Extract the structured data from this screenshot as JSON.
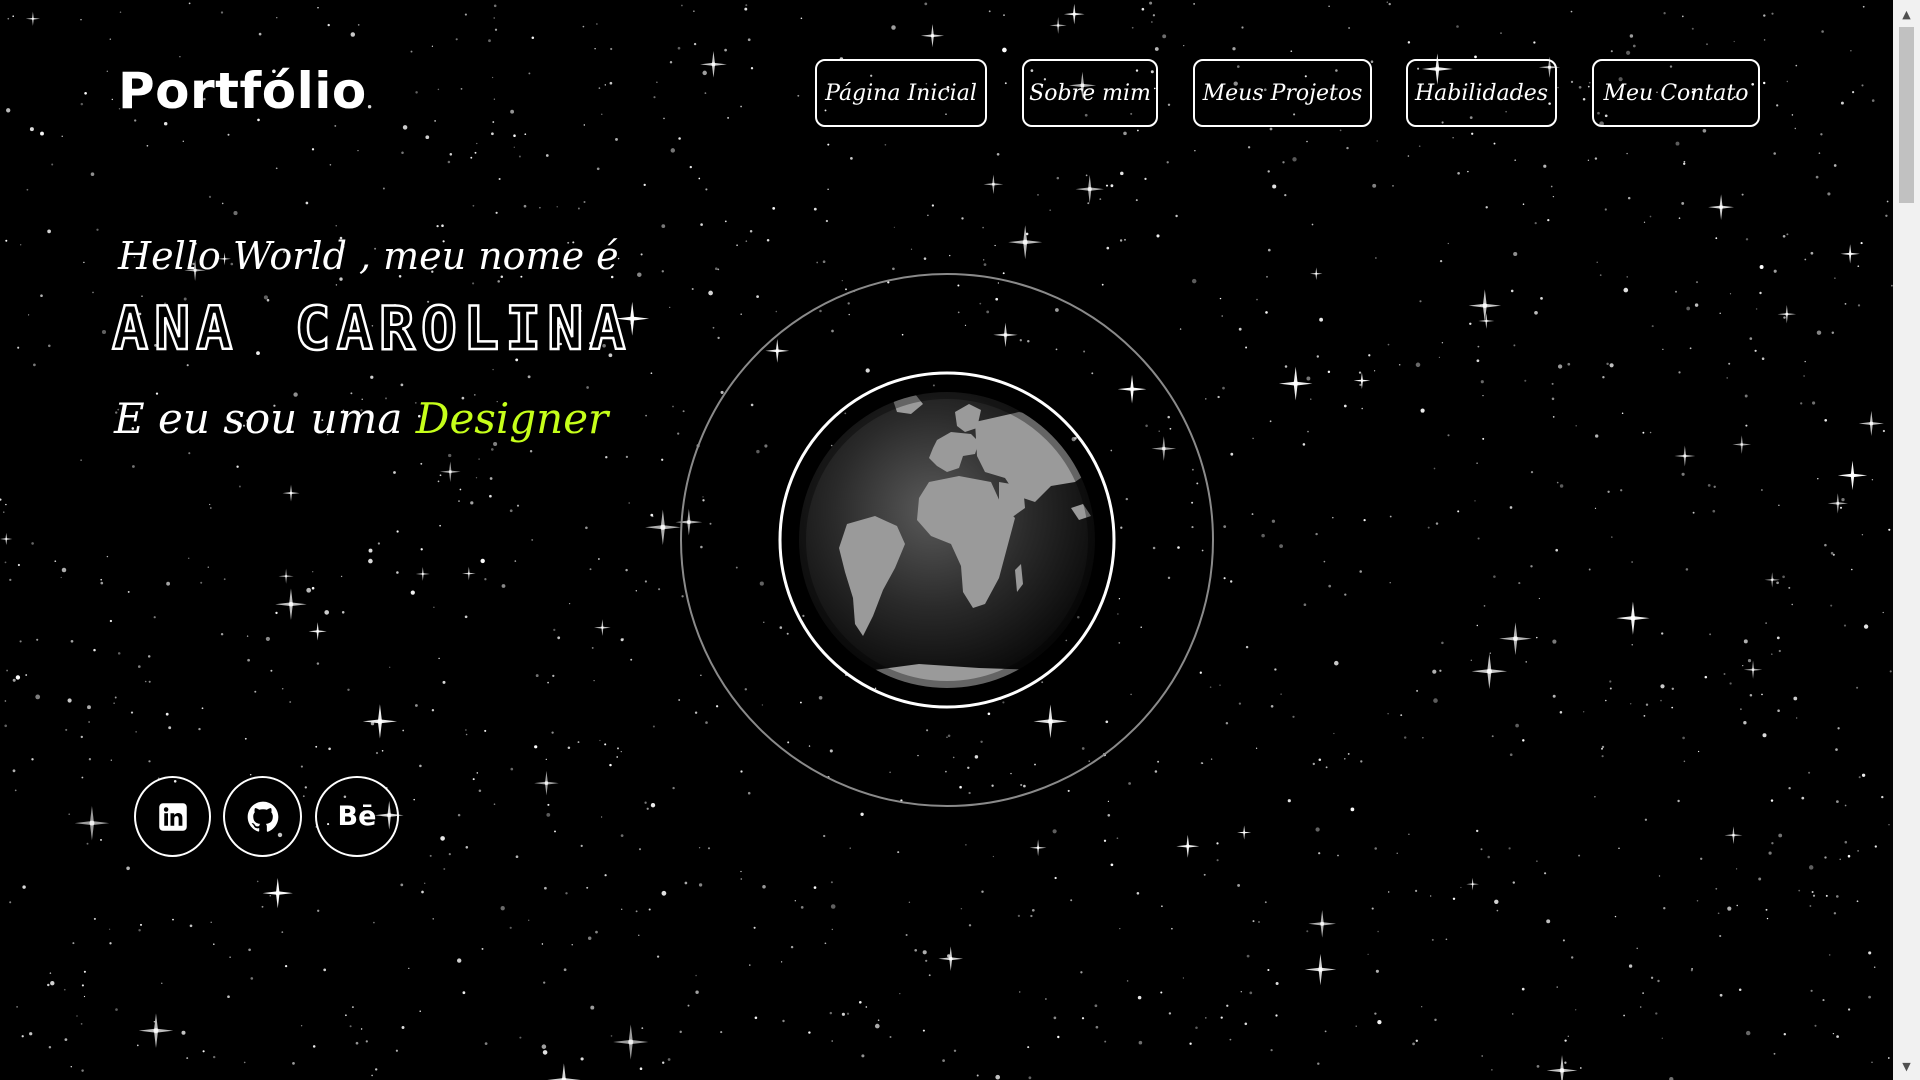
{
  "header": {
    "logo": "Portfólio",
    "nav": [
      {
        "label": "Página Inicial",
        "name": "nav-pagina-inicial"
      },
      {
        "label": "Sobre mim",
        "name": "nav-sobre-mim"
      },
      {
        "label": "Meus Projetos",
        "name": "nav-meus-projetos"
      },
      {
        "label": "Habilidades",
        "name": "nav-habilidades"
      },
      {
        "label": "Meu Contato",
        "name": "nav-meu-contato"
      }
    ]
  },
  "hero": {
    "greeting": "Hello World , meu nome é",
    "name": "ANA CAROLINA",
    "role_prefix": "E eu sou uma",
    "role": "Designer"
  },
  "social": [
    {
      "icon": "linkedin-icon"
    },
    {
      "icon": "github-icon"
    },
    {
      "icon": "behance-icon",
      "label": "Bē"
    }
  ],
  "colors": {
    "background": "#000000",
    "text": "#ffffff",
    "accent": "#c6ff1a"
  }
}
